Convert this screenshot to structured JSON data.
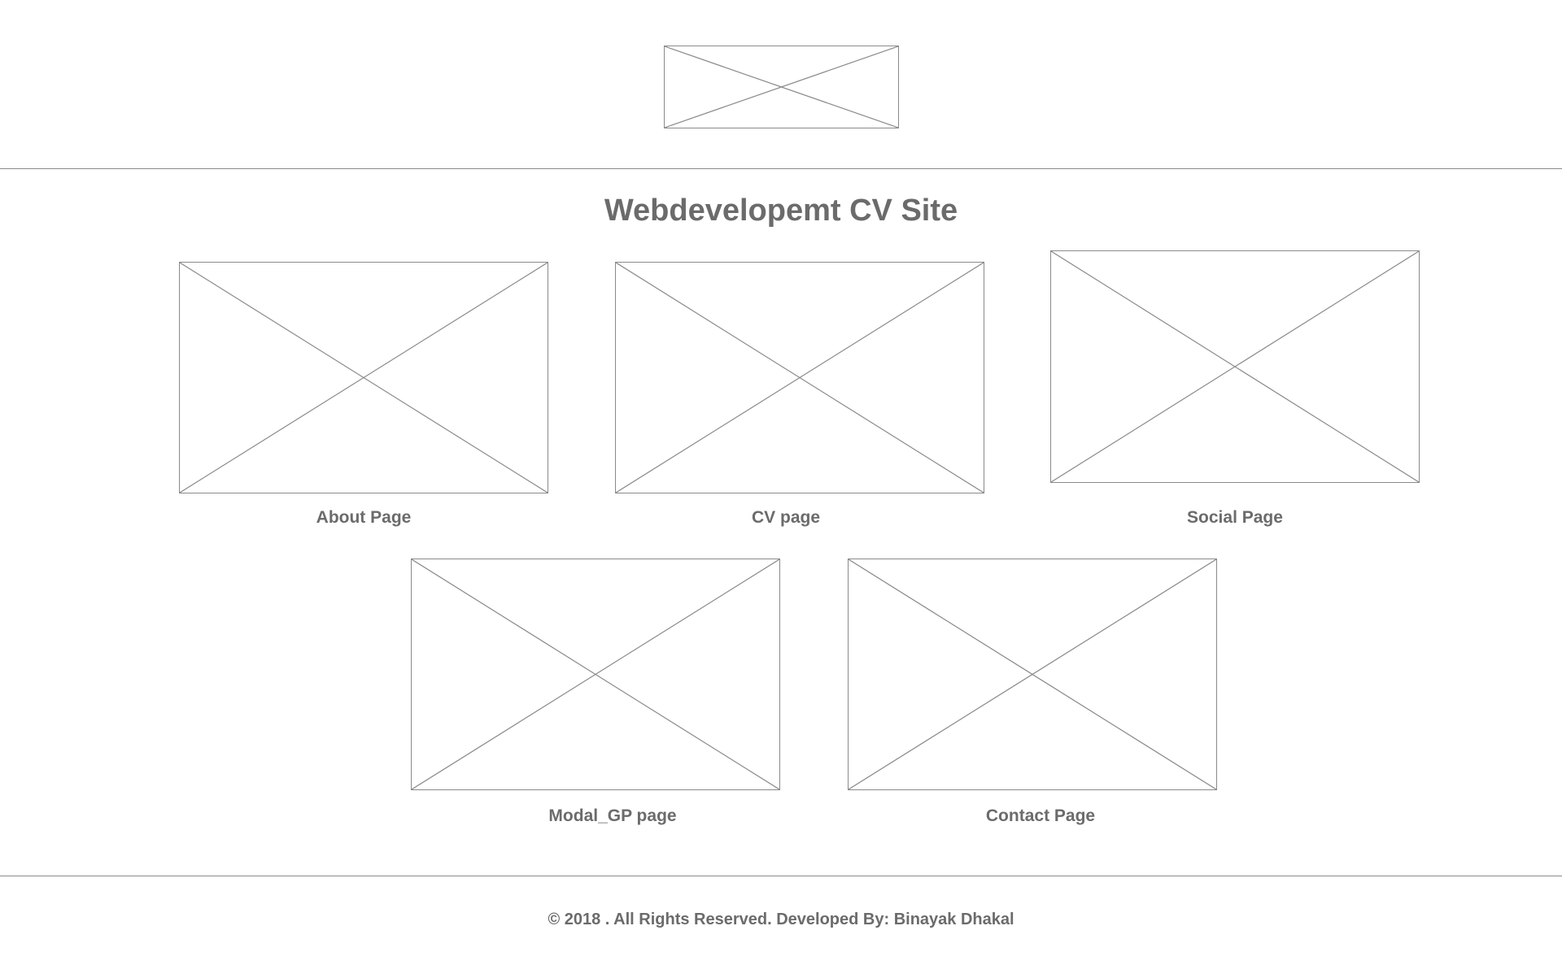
{
  "header": {
    "logo_icon": "image-placeholder-icon"
  },
  "main": {
    "title": "Webdevelopemt CV Site",
    "cards": [
      {
        "label": "About Page",
        "icon": "image-placeholder-icon"
      },
      {
        "label": "CV page",
        "icon": "image-placeholder-icon"
      },
      {
        "label": "Social Page",
        "icon": "image-placeholder-icon"
      },
      {
        "label": "Modal_GP page",
        "icon": "image-placeholder-icon"
      },
      {
        "label": "Contact Page",
        "icon": "image-placeholder-icon"
      }
    ]
  },
  "footer": {
    "text": "© 2018 . All Rights Reserved. Developed By: Binayak Dhakal"
  },
  "colors": {
    "background": "#ffffff",
    "stroke": "#8a8a8a",
    "text": "#6b6b6b"
  }
}
